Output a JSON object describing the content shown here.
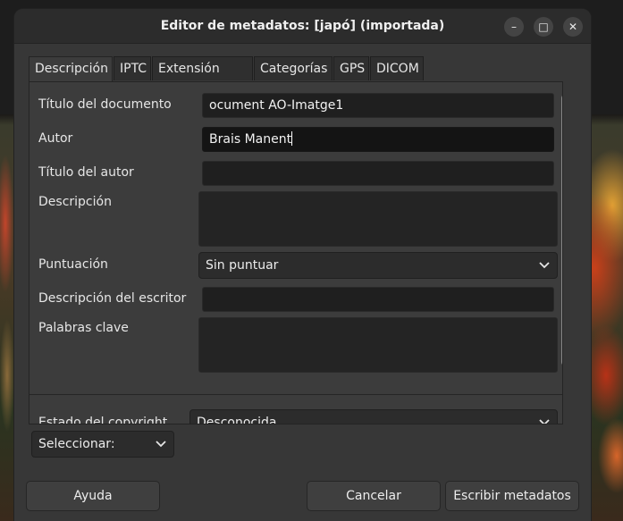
{
  "window": {
    "title": "Editor de metadatos: [japó] (importada)",
    "minimize_glyph": "–",
    "maximize_glyph": "□",
    "close_glyph": "✕"
  },
  "tabs": [
    {
      "label": "Descripción",
      "active": true
    },
    {
      "label": "IPTC"
    },
    {
      "label": "Extensión IPTC"
    },
    {
      "label": "Categorías"
    },
    {
      "label": "GPS"
    },
    {
      "label": "DICOM"
    }
  ],
  "fields": {
    "document_title": {
      "label": "Título del documento",
      "value": "ocument AO-Imatge1"
    },
    "author": {
      "label": "Autor",
      "value": "Brais Manent"
    },
    "author_title": {
      "label": "Título del autor",
      "value": ""
    },
    "description": {
      "label": "Descripción",
      "value": ""
    },
    "rating": {
      "label": "Puntuación",
      "value": "Sin puntuar"
    },
    "writer_description": {
      "label": "Descripción del escritor",
      "value": ""
    },
    "keywords": {
      "label": "Palabras clave",
      "value": ""
    },
    "copyright_status": {
      "label": "Estado del copyright",
      "value": "Desconocida"
    }
  },
  "select_combo": {
    "value": "Seleccionar:"
  },
  "buttons": {
    "help": "Ayuda",
    "cancel": "Cancelar",
    "write": "Escribir metadatos"
  },
  "colors": {
    "dialog_bg": "#373737",
    "titlebar_bg": "#2c2c2c",
    "field_bg": "#1f1f1f"
  }
}
